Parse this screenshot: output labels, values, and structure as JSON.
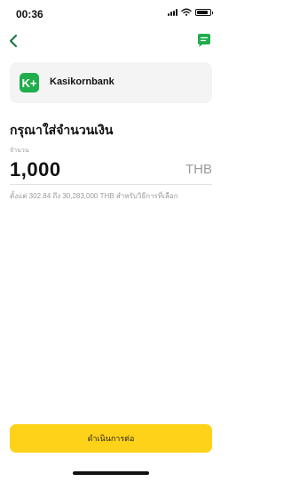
{
  "status_bar": {
    "time": "00:36"
  },
  "bank": {
    "name": "Kasikornbank",
    "logo_text": "K+"
  },
  "form": {
    "title": "กรุณาใส่จำนวนเงิน",
    "amount_label": "จำนวน",
    "amount_value": "1,000",
    "currency": "THB",
    "hint": "ตั้งแต่ 302.84 ถึง 30,283,000 THB สำหรับวิธีการที่เลือก"
  },
  "actions": {
    "continue_label": "ดำเนินการต่อ"
  },
  "colors": {
    "accent": "#ffd21a",
    "bank_green": "#1fae4b",
    "back_arrow": "#1e7a4a"
  },
  "icons": {
    "back": "chevron-left-icon",
    "chat": "chat-icon",
    "signal": "signal-icon",
    "wifi": "wifi-icon",
    "battery": "battery-icon"
  }
}
